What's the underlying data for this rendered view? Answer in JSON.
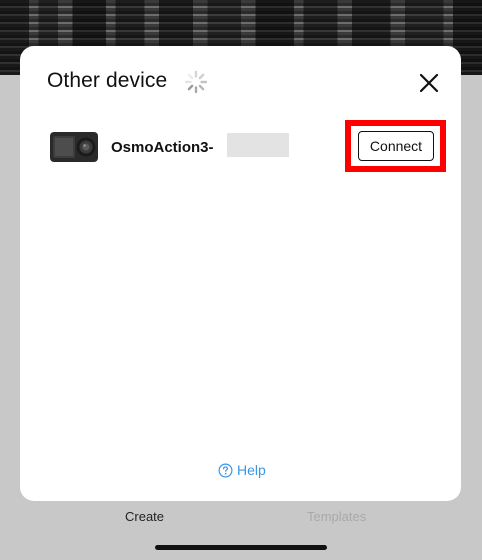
{
  "modal": {
    "title": "Other device",
    "spinner_icon": "loading-spinner-icon",
    "close_icon": "close-icon"
  },
  "device": {
    "name": "OsmoAction3-",
    "icon": "action-camera-icon",
    "connect_label": "Connect"
  },
  "help": {
    "label": "Help",
    "icon": "help-circle-icon"
  },
  "tabs": {
    "create": "Create",
    "templates": "Templates"
  },
  "colors": {
    "highlight": "#ff0000",
    "help_link": "#3a96e6"
  }
}
